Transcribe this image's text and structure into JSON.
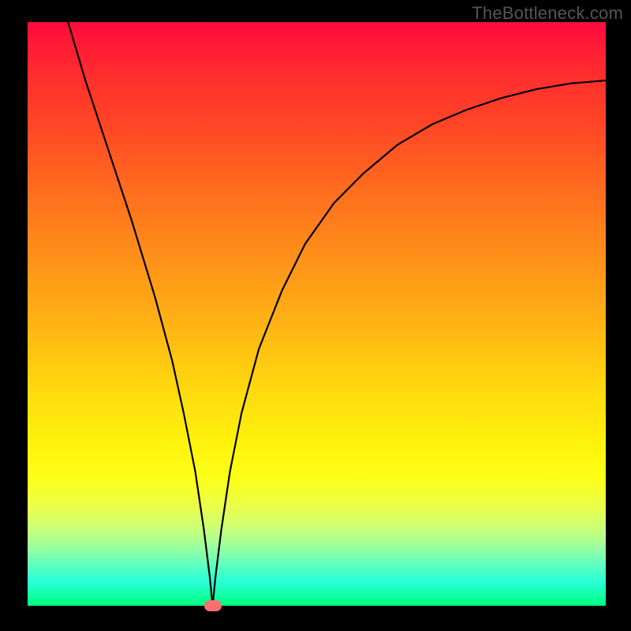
{
  "watermark": "TheBottleneck.com",
  "chart_data": {
    "type": "line",
    "title": "",
    "xlabel": "",
    "ylabel": "",
    "xlim": [
      0,
      100
    ],
    "ylim": [
      0,
      100
    ],
    "grid": false,
    "legend": false,
    "series": [
      {
        "name": "bottleneck-curve",
        "x": [
          7,
          10,
          14,
          18,
          22,
          25,
          27,
          29,
          30.5,
          31.5,
          32,
          32.5,
          33.5,
          35,
          37,
          40,
          44,
          48,
          53,
          58,
          64,
          70,
          76,
          82,
          88,
          94,
          100
        ],
        "y": [
          100,
          90,
          78,
          66,
          53,
          42,
          33,
          23,
          13,
          5,
          0,
          5,
          13,
          23,
          33,
          44,
          54,
          62,
          69,
          74,
          79,
          82.5,
          85,
          87,
          88.5,
          89.5,
          90
        ]
      }
    ],
    "markers": [
      {
        "name": "current-point",
        "x": 32,
        "y": 0,
        "color": "#ff6f6f"
      }
    ],
    "colors": {
      "curve": "#000000",
      "background_top": "#ff0a3c",
      "background_bottom": "#00ff7e"
    }
  }
}
